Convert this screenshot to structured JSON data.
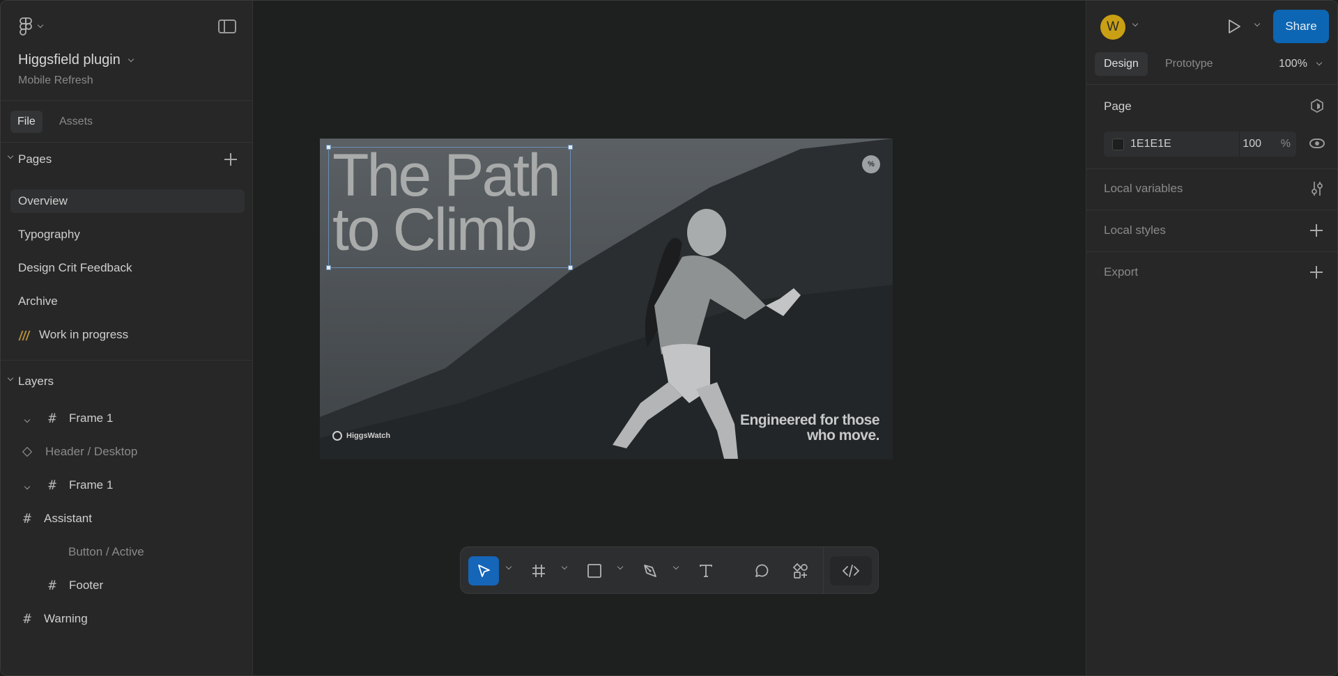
{
  "app": {
    "project_title": "Higgsfield plugin",
    "project_subtitle": "Mobile Refresh"
  },
  "left_tabs": [
    "File",
    "Assets"
  ],
  "pages": {
    "header": "Pages",
    "items": [
      "Overview",
      "Typography",
      "Design Crit Feedback",
      "Archive",
      "Work in progress"
    ],
    "selected": "Overview"
  },
  "layers": {
    "header": "Layers",
    "items": [
      {
        "name": "Frame 1",
        "type": "frame"
      },
      {
        "name": "Header / Desktop",
        "type": "component"
      },
      {
        "name": "Frame 1",
        "type": "frame"
      },
      {
        "name": "Assistant",
        "type": "frame"
      },
      {
        "name": "Button / Active",
        "type": "instance"
      },
      {
        "name": "Footer",
        "type": "frame"
      },
      {
        "name": "Warning",
        "type": "frame"
      }
    ]
  },
  "canvas": {
    "headline_line1": "The Path",
    "headline_line2": "to Climb",
    "brand": "HiggsWatch",
    "tagline_line1": "Engineered for those",
    "tagline_line2": "who move."
  },
  "toolbar": {
    "tools": [
      "move-tool",
      "frame-tool",
      "rectangle-tool",
      "pen-tool",
      "text-tool",
      "comment-tool",
      "actions-tool",
      "dev-mode-tool"
    ],
    "active": "move-tool"
  },
  "right_panel": {
    "avatar_initial": "W",
    "share_label": "Share",
    "tabs": [
      "Design",
      "Prototype"
    ],
    "active_tab": "Design",
    "zoom": "100%",
    "page_header": "Page",
    "page_color_hex": "1E1E1E",
    "page_opacity": "100",
    "opacity_unit": "%",
    "local_variables": "Local variables",
    "local_styles": "Local styles",
    "export": "Export"
  },
  "colors": {
    "accent": "#0d66b3",
    "avatar": "#c9a013",
    "panel": "#272728",
    "canvas": "#1e1f1f"
  }
}
